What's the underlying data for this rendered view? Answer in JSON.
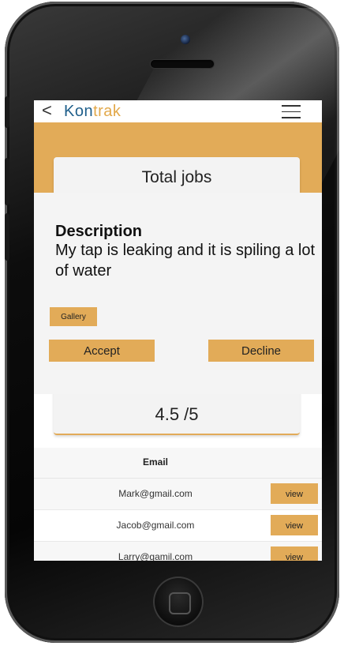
{
  "app": {
    "brand_part1": "Kon",
    "brand_part2": "trak",
    "back_glyph": "<"
  },
  "summary_card": {
    "title": "Total jobs",
    "rating": "4.5 /5"
  },
  "dialog": {
    "description_label": "Description",
    "description_text": "My tap is leaking and it is spiling a lot of water",
    "gallery_label": "Gallery",
    "accept_label": "Accept",
    "decline_label": "Decline"
  },
  "table": {
    "header_email": "Email",
    "rows": [
      {
        "email": "Mark@gmail.com",
        "action": "view"
      },
      {
        "email": "Jacob@gmail.com",
        "action": "view"
      },
      {
        "email": "Larry@gamil.com",
        "action": "view"
      }
    ]
  },
  "colors": {
    "accent": "#e2ab58",
    "brand_blue": "#1f5f8b"
  },
  "icons": {
    "back": "chevron-left-icon",
    "menu": "hamburger-menu-icon"
  }
}
